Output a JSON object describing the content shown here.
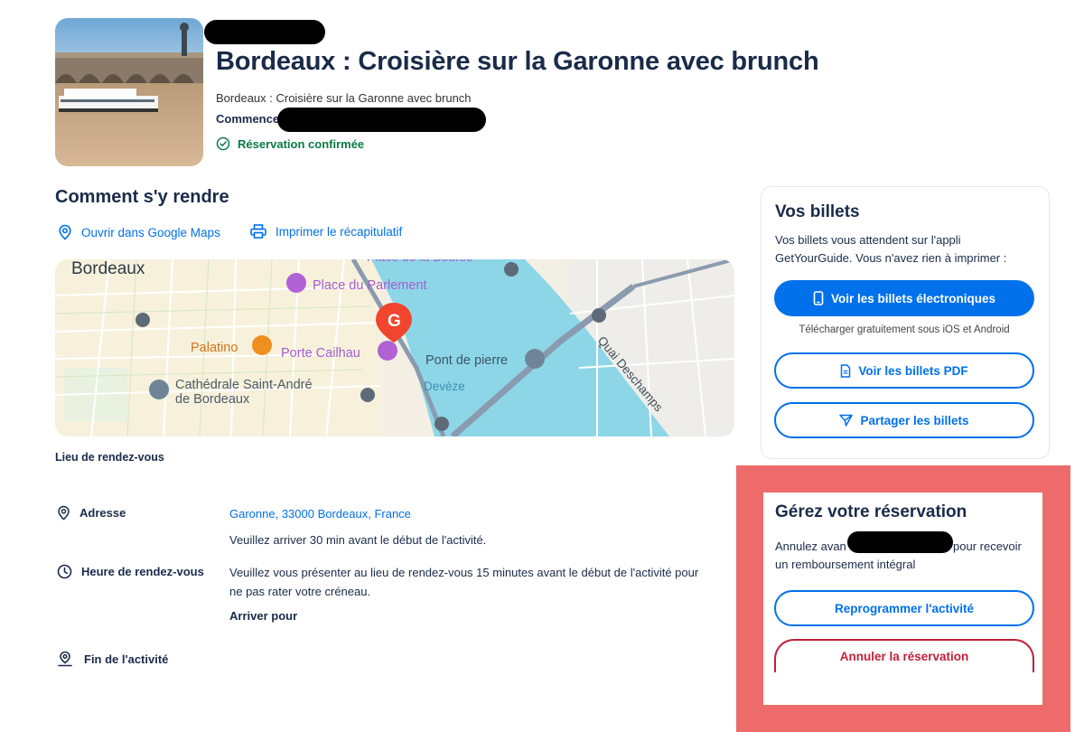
{
  "header": {
    "title": "Bordeaux : Croisière sur la Garonne avec brunch",
    "subtitle": "Bordeaux : Croisière sur la Garonne avec brunch",
    "starts_label": "Commence",
    "status": "Réservation confirmée"
  },
  "directions": {
    "heading": "Comment s'y rendre",
    "open_maps": "Ouvrir dans Google Maps",
    "print_summary": "Imprimer le récapitulatif",
    "map": {
      "city": "Bordeaux",
      "places": [
        "Place de la Bourse",
        "Place du Parlement",
        "Palatino",
        "Porte Cailhau",
        "Pont de pierre",
        "Cathédrale Saint-André",
        "de Bordeaux",
        "Devèze",
        "Quai Deschamps"
      ],
      "pin_letter": "G"
    },
    "meeting_point_label": "Lieu de rendez-vous",
    "address_label": "Adresse",
    "address_value": "Garonne, 33000 Bordeaux, France",
    "arrive_note": "Veuillez arriver 30 min avant le début de l'activité.",
    "meeting_time_label": "Heure de rendez-vous",
    "meeting_time_text_1": "Veuillez vous présenter au lieu de rendez-vous 15 minutes avant le début de l'activité pour",
    "meeting_time_text_2": "ne pas rater votre créneau.",
    "arrive_for": "Arriver pour",
    "end_label": "Fin de l'activité"
  },
  "tickets": {
    "title": "Vos billets",
    "text_1": "Vos billets vous attendent sur l'appli",
    "text_2": "GetYourGuide. Vous n'avez rien à imprimer :",
    "btn_electronic": "Voir les billets électroniques",
    "download_note": "Télécharger gratuitement sous iOS et Android",
    "btn_pdf": "Voir les billets PDF",
    "btn_share": "Partager les billets"
  },
  "manage": {
    "title": "Gérez votre réservation",
    "text_1a": "Annulez avan",
    "text_1b": "pour recevoir",
    "text_2": "un remboursement intégral",
    "btn_reschedule": "Reprogrammer l'activité",
    "btn_cancel": "Annuler la réservation"
  },
  "colors": {
    "primary": "#0071eb",
    "heading": "#1a2b49",
    "success": "#0a7a46",
    "danger": "#c21f3a",
    "highlight": "#ee6b6b"
  }
}
